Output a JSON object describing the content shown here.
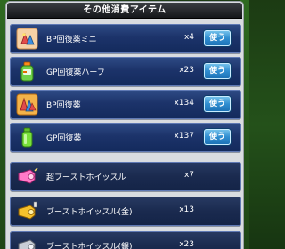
{
  "header": {
    "title": "その他消費アイテム"
  },
  "items": [
    {
      "label": "BP回復薬ミニ",
      "count": "x4",
      "button": "使う",
      "icon": "bp-mini-potion-icon"
    },
    {
      "label": "GP回復薬ハーフ",
      "count": "x23",
      "button": "使う",
      "icon": "gp-half-bottle-icon"
    },
    {
      "label": "BP回復薬",
      "count": "x134",
      "button": "使う",
      "icon": "bp-potion-icon"
    },
    {
      "label": "GP回復薬",
      "count": "x137",
      "button": "使う",
      "icon": "gp-bottle-icon"
    },
    {
      "label": "超ブーストホイッスル",
      "count": "x7",
      "button": "",
      "icon": "pink-whistle-icon"
    },
    {
      "label": "ブーストホイッスル(金)",
      "count": "x13",
      "button": "",
      "icon": "gold-whistle-icon"
    },
    {
      "label": "ブーストホイッスル(銀)",
      "count": "x23",
      "button": "",
      "icon": "silver-whistle-icon"
    }
  ],
  "colors": {
    "background": "#24511a",
    "row": "#1c336a",
    "use_button": "#2f8dd0",
    "title_bar": "#15171a"
  }
}
